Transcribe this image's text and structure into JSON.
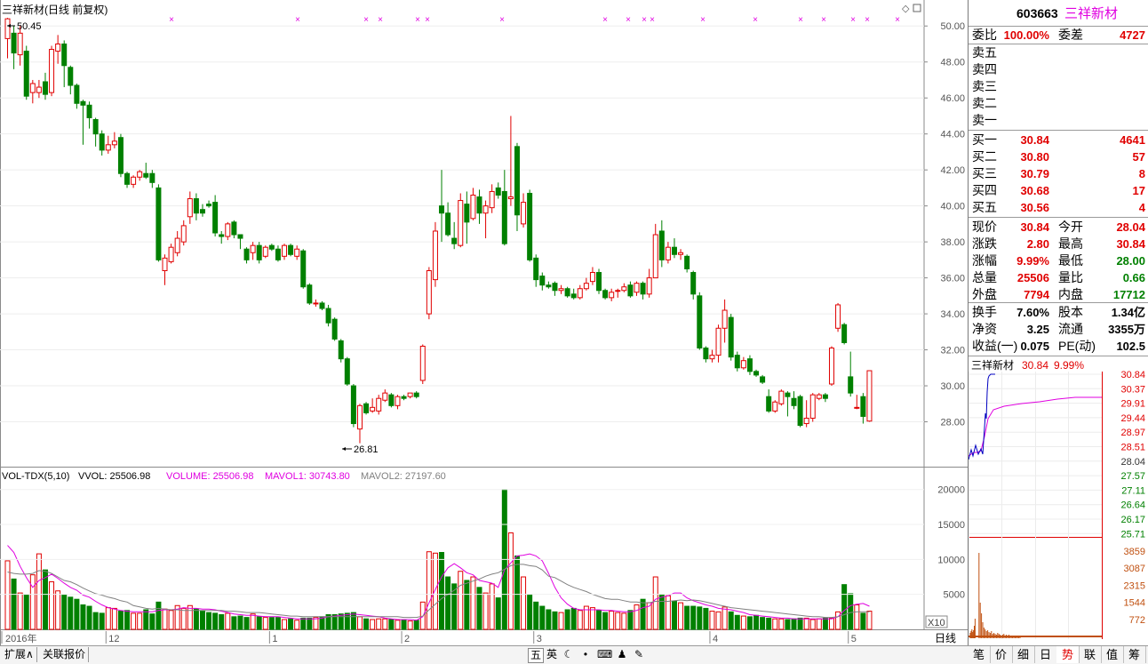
{
  "chart_title": "三祥新材(日线 前复权)",
  "high_marker": "50.45",
  "low_marker": "26.81",
  "price_axis": [
    "50.00",
    "48.00",
    "46.00",
    "44.00",
    "42.00",
    "40.00",
    "38.00",
    "36.00",
    "34.00",
    "32.00",
    "30.00",
    "28.00"
  ],
  "vol_indicator": {
    "name": "VOL-TDX(5,10)",
    "vvol": "VVOL: 25506.98",
    "volume": "VOLUME: 25506.98",
    "mavol1": "MAVOL1: 30743.80",
    "mavol2": "MAVOL2: 27197.60"
  },
  "vol_axis": [
    "20000",
    "15000",
    "10000",
    "5000"
  ],
  "vol_unit": "X10",
  "x_axis": [
    "2016年",
    "12",
    "1",
    "2",
    "3",
    "4",
    "5"
  ],
  "period_label": "日线",
  "bottom_tabs": [
    "扩展∧",
    "关联报价"
  ],
  "ime": {
    "label1": "五",
    "label2": "英"
  },
  "quote": {
    "code": "603663",
    "name": "三祥新材",
    "weibi_label": "委比",
    "weibi": "100.00%",
    "weicha_label": "委差",
    "weicha": "4727",
    "sell": [
      {
        "label": "卖五"
      },
      {
        "label": "卖四"
      },
      {
        "label": "卖三"
      },
      {
        "label": "卖二"
      },
      {
        "label": "卖一"
      }
    ],
    "buy": [
      {
        "label": "买一",
        "price": "30.84",
        "vol": "4641"
      },
      {
        "label": "买二",
        "price": "30.80",
        "vol": "57"
      },
      {
        "label": "买三",
        "price": "30.79",
        "vol": "8"
      },
      {
        "label": "买四",
        "price": "30.68",
        "vol": "17"
      },
      {
        "label": "买五",
        "price": "30.56",
        "vol": "4"
      }
    ],
    "stats": [
      {
        "l1": "现价",
        "v1": "30.84",
        "l2": "今开",
        "v2": "28.04",
        "c1": "red",
        "c2": "red"
      },
      {
        "l1": "涨跌",
        "v1": "2.80",
        "l2": "最高",
        "v2": "30.84",
        "c1": "red",
        "c2": "red"
      },
      {
        "l1": "涨幅",
        "v1": "9.99%",
        "l2": "最低",
        "v2": "28.00",
        "c1": "red",
        "c2": "green"
      },
      {
        "l1": "总量",
        "v1": "25506",
        "l2": "量比",
        "v2": "0.66",
        "c1": "red",
        "c2": "green"
      },
      {
        "l1": "外盘",
        "v1": "7794",
        "l2": "内盘",
        "v2": "17712",
        "c1": "red",
        "c2": "green"
      }
    ],
    "fin": [
      {
        "l1": "换手",
        "v1": "7.60%",
        "l2": "股本",
        "v2": "1.34亿"
      },
      {
        "l1": "净资",
        "v1": "3.25",
        "l2": "流通",
        "v2": "3355万"
      },
      {
        "l1": "收益(一)",
        "v1": "0.075",
        "l2": "PE(动)",
        "v2": "102.5"
      }
    ],
    "mini_title": "三祥新材",
    "mini_price": "30.84",
    "mini_pct": "9.99%",
    "mini_axis": [
      "30.84",
      "30.37",
      "29.91",
      "29.44",
      "28.97",
      "28.51",
      "28.04",
      "27.57",
      "27.11",
      "26.64",
      "26.17",
      "25.71"
    ],
    "mini_vol_axis": [
      "3859",
      "3087",
      "2315",
      "1544",
      "772"
    ],
    "side_tabs": [
      "笔",
      "价",
      "细",
      "日",
      "势",
      "联",
      "值",
      "筹"
    ]
  },
  "colors": {
    "up": "#e00000",
    "down": "#008000",
    "ma1": "#e000e0",
    "ma2": "#808080",
    "axis": "#e00000"
  },
  "chart_data": {
    "type": "candlestick",
    "title": "三祥新材(日线 前复权)",
    "ylim": [
      26.0,
      51.0
    ],
    "x_ticks": [
      "2016年",
      "12",
      "1",
      "2",
      "3",
      "4",
      "5"
    ],
    "candles": [
      [
        49.3,
        50.4,
        48.2,
        50.45
      ],
      [
        49.6,
        48.5,
        47.6,
        50.0
      ],
      [
        48.4,
        49.6,
        47.8,
        50.0
      ],
      [
        48.6,
        46.1,
        45.9,
        48.9
      ],
      [
        46.3,
        46.8,
        45.7,
        47.0
      ],
      [
        46.3,
        46.6,
        46.0,
        47.0
      ],
      [
        46.9,
        46.2,
        45.9,
        47.4
      ],
      [
        46.3,
        48.7,
        46.1,
        48.9
      ],
      [
        48.6,
        49.0,
        47.9,
        49.5
      ],
      [
        49.0,
        47.8,
        46.6,
        49.2
      ],
      [
        47.7,
        46.7,
        46.2,
        47.8
      ],
      [
        46.7,
        45.7,
        45.4,
        46.8
      ],
      [
        45.8,
        45.6,
        43.4,
        45.9
      ],
      [
        45.6,
        44.9,
        44.3,
        45.8
      ],
      [
        44.8,
        44.0,
        43.3,
        44.9
      ],
      [
        44.0,
        43.1,
        42.8,
        44.2
      ],
      [
        43.1,
        43.4,
        42.9,
        43.9
      ],
      [
        43.4,
        43.6,
        43.2,
        44.1
      ],
      [
        43.8,
        41.8,
        41.6,
        44.0
      ],
      [
        41.8,
        41.2,
        41.0,
        41.9
      ],
      [
        41.2,
        41.6,
        41.0,
        41.7
      ],
      [
        41.6,
        41.9,
        41.4,
        42.0
      ],
      [
        41.8,
        41.6,
        41.5,
        42.4
      ],
      [
        41.8,
        41.3,
        41.0,
        42.0
      ],
      [
        41.0,
        37.0,
        36.9,
        41.2
      ],
      [
        36.4,
        37.1,
        35.6,
        37.3
      ],
      [
        36.9,
        37.7,
        36.8,
        37.9
      ],
      [
        37.4,
        38.2,
        37.2,
        38.6
      ],
      [
        38.0,
        38.9,
        37.8,
        39.2
      ],
      [
        39.4,
        40.4,
        39.0,
        40.8
      ],
      [
        40.4,
        39.6,
        39.2,
        40.7
      ],
      [
        39.8,
        39.6,
        39.4,
        40.1
      ],
      [
        40.1,
        40.0,
        39.9,
        40.3
      ],
      [
        40.2,
        38.5,
        38.3,
        40.6
      ],
      [
        38.4,
        38.3,
        37.9,
        38.6
      ],
      [
        38.3,
        39.0,
        38.1,
        39.1
      ],
      [
        39.1,
        38.4,
        38.2,
        39.2
      ],
      [
        38.4,
        38.2,
        37.6,
        38.4
      ],
      [
        37.6,
        37.0,
        36.8,
        37.7
      ],
      [
        37.4,
        37.8,
        37.0,
        38.0
      ],
      [
        37.8,
        37.0,
        36.8,
        38.0
      ],
      [
        37.2,
        37.7,
        37.1,
        37.8
      ],
      [
        37.8,
        37.6,
        37.5,
        37.9
      ],
      [
        37.6,
        37.0,
        36.9,
        37.8
      ],
      [
        37.2,
        37.8,
        37.0,
        37.9
      ],
      [
        37.8,
        37.3,
        37.2,
        37.9
      ],
      [
        37.2,
        37.6,
        37.0,
        37.8
      ],
      [
        37.5,
        35.5,
        35.4,
        37.6
      ],
      [
        35.6,
        34.6,
        34.5,
        35.7
      ],
      [
        34.6,
        34.6,
        34.4,
        34.8
      ],
      [
        34.6,
        34.3,
        34.2,
        34.7
      ],
      [
        34.3,
        33.5,
        33.3,
        34.5
      ],
      [
        33.7,
        32.6,
        32.5,
        33.8
      ],
      [
        32.5,
        31.5,
        31.3,
        32.6
      ],
      [
        31.5,
        30.1,
        30.0,
        31.6
      ],
      [
        30.0,
        27.9,
        27.7,
        30.1
      ],
      [
        27.6,
        28.9,
        26.81,
        29.0
      ],
      [
        29.0,
        28.5,
        28.4,
        29.1
      ],
      [
        28.6,
        28.8,
        28.5,
        29.3
      ],
      [
        28.6,
        29.3,
        28.4,
        29.5
      ],
      [
        29.2,
        29.6,
        29.1,
        29.8
      ],
      [
        29.5,
        28.9,
        28.8,
        29.6
      ],
      [
        28.9,
        29.4,
        28.7,
        29.5
      ],
      [
        29.4,
        29.3,
        29.2,
        29.5
      ],
      [
        29.4,
        29.6,
        29.3,
        29.6
      ],
      [
        29.6,
        29.4,
        29.3,
        29.7
      ],
      [
        30.3,
        32.2,
        30.1,
        32.3
      ],
      [
        34.0,
        36.4,
        33.7,
        36.6
      ],
      [
        35.9,
        38.6,
        35.5,
        39.1
      ],
      [
        40.0,
        39.6,
        38.0,
        42.0
      ],
      [
        39.6,
        38.4,
        38.3,
        40.2
      ],
      [
        38.2,
        37.9,
        37.6,
        39.1
      ],
      [
        37.8,
        40.3,
        37.7,
        40.7
      ],
      [
        40.1,
        39.1,
        37.9,
        40.8
      ],
      [
        39.3,
        40.6,
        39.2,
        41.0
      ],
      [
        40.5,
        39.6,
        39.0,
        40.9
      ],
      [
        39.6,
        40.0,
        38.2,
        40.3
      ],
      [
        39.9,
        40.8,
        39.6,
        41.2
      ],
      [
        41.0,
        40.6,
        40.4,
        41.3
      ],
      [
        40.8,
        37.9,
        37.8,
        42.0
      ],
      [
        40.4,
        40.5,
        40.0,
        45.0
      ],
      [
        43.3,
        39.5,
        38.6,
        43.5
      ],
      [
        39.0,
        40.2,
        38.8,
        40.7
      ],
      [
        40.7,
        37.0,
        36.9,
        40.9
      ],
      [
        37.1,
        35.9,
        35.5,
        37.3
      ],
      [
        36.1,
        35.6,
        35.3,
        36.3
      ],
      [
        35.6,
        35.5,
        35.4,
        35.8
      ],
      [
        35.7,
        35.3,
        35.0,
        35.8
      ],
      [
        35.3,
        35.4,
        35.1,
        35.6
      ],
      [
        35.4,
        35.0,
        34.9,
        35.5
      ],
      [
        35.1,
        34.9,
        34.8,
        35.4
      ],
      [
        34.9,
        35.4,
        34.8,
        35.6
      ],
      [
        35.4,
        35.7,
        35.3,
        36.0
      ],
      [
        35.8,
        36.3,
        35.6,
        36.6
      ],
      [
        36.3,
        35.3,
        35.1,
        36.5
      ],
      [
        35.3,
        34.9,
        34.8,
        35.4
      ],
      [
        34.9,
        35.2,
        34.7,
        35.4
      ],
      [
        35.3,
        35.3,
        34.9,
        35.4
      ],
      [
        35.3,
        35.5,
        35.2,
        35.7
      ],
      [
        35.6,
        35.0,
        34.9,
        35.8
      ],
      [
        35.2,
        35.7,
        35.0,
        35.8
      ],
      [
        35.7,
        35.1,
        34.8,
        35.8
      ],
      [
        35.1,
        36.0,
        34.9,
        36.5
      ],
      [
        36.0,
        38.4,
        36.0,
        39.0
      ],
      [
        38.6,
        37.0,
        36.6,
        39.2
      ],
      [
        37.0,
        37.7,
        36.8,
        38.0
      ],
      [
        37.7,
        37.3,
        37.1,
        38.2
      ],
      [
        37.3,
        37.4,
        37.0,
        37.6
      ],
      [
        37.2,
        36.5,
        36.3,
        37.3
      ],
      [
        36.3,
        35.1,
        34.8,
        36.4
      ],
      [
        35.0,
        32.1,
        32.0,
        35.2
      ],
      [
        32.1,
        31.5,
        31.3,
        32.2
      ],
      [
        31.5,
        31.7,
        31.3,
        32.0
      ],
      [
        31.7,
        33.2,
        31.3,
        33.4
      ],
      [
        33.2,
        34.2,
        32.4,
        34.8
      ],
      [
        33.8,
        31.6,
        31.4,
        34.0
      ],
      [
        31.7,
        31.0,
        30.8,
        31.9
      ],
      [
        31.0,
        31.4,
        30.9,
        31.6
      ],
      [
        31.5,
        30.8,
        30.6,
        31.7
      ],
      [
        30.8,
        30.6,
        30.5,
        30.9
      ],
      [
        30.5,
        30.2,
        30.1,
        30.6
      ],
      [
        29.4,
        28.6,
        28.5,
        29.8
      ],
      [
        28.6,
        29.1,
        28.5,
        29.2
      ],
      [
        29.0,
        29.7,
        28.9,
        29.8
      ],
      [
        29.6,
        29.4,
        28.3,
        29.7
      ],
      [
        29.3,
        28.9,
        28.7,
        29.7
      ],
      [
        29.4,
        27.8,
        27.7,
        29.5
      ],
      [
        27.9,
        28.2,
        27.7,
        29.2
      ],
      [
        28.2,
        29.5,
        28.0,
        29.6
      ],
      [
        29.3,
        29.5,
        29.2,
        29.6
      ],
      [
        29.5,
        29.3,
        29.1,
        29.6
      ],
      [
        30.1,
        32.1,
        30.0,
        32.2
      ],
      [
        33.2,
        34.5,
        33.0,
        34.6
      ],
      [
        33.4,
        32.4,
        32.3,
        33.5
      ],
      [
        30.5,
        29.6,
        29.4,
        31.9
      ],
      [
        28.8,
        28.8,
        28.7,
        29.5
      ],
      [
        29.4,
        28.3,
        27.9,
        29.6
      ],
      [
        28.04,
        30.84,
        28.0,
        30.84
      ]
    ],
    "volume": [
      9800,
      7200,
      5200,
      4900,
      7800,
      10800,
      8500,
      6800,
      5500,
      4900,
      4600,
      4300,
      3500,
      3300,
      2400,
      2300,
      3100,
      3000,
      2600,
      2700,
      2300,
      2300,
      2800,
      2200,
      3900,
      2900,
      2700,
      3400,
      3000,
      3400,
      2900,
      2600,
      2400,
      2300,
      2100,
      2300,
      1800,
      1900,
      1700,
      2200,
      1800,
      1700,
      1700,
      1700,
      1400,
      1500,
      1300,
      1600,
      1600,
      1700,
      1800,
      2100,
      2100,
      2200,
      2300,
      2400,
      1800,
      1500,
      1400,
      1500,
      1500,
      1400,
      1300,
      1300,
      1200,
      1300,
      3900,
      11100,
      10900,
      11000,
      7500,
      6500,
      8300,
      7000,
      7500,
      6000,
      5200,
      6500,
      4500,
      20000,
      13800,
      10500,
      7500,
      5000,
      3900,
      3300,
      2800,
      2500,
      2400,
      2800,
      3000,
      2700,
      3300,
      3100,
      2700,
      2400,
      2600,
      2400,
      2300,
      2700,
      3500,
      4300,
      3800,
      7500,
      5000,
      4800,
      4000,
      3800,
      3300,
      3300,
      3200,
      3000,
      2600,
      2500,
      3200,
      2500,
      2000,
      1900,
      1800,
      2000,
      1700,
      1600,
      1500,
      1500,
      1400,
      1500,
      1600,
      1600,
      1400,
      1500,
      1600,
      1600,
      2500,
      6400,
      5100,
      3500,
      2300,
      2600
    ],
    "mavol1": [
      12000,
      11000,
      9000,
      7400,
      6000,
      7000,
      7400,
      7900,
      7300,
      6600,
      6000,
      5600,
      4900,
      4600,
      4000,
      3500,
      3100,
      2900,
      2700,
      2600,
      2500,
      2500,
      2500,
      2500,
      2700,
      2800,
      2800,
      2900,
      3100,
      3000,
      3000,
      2900,
      2900,
      2800,
      2600,
      2400,
      2200,
      2100,
      2000,
      2000,
      1900,
      1800,
      1800,
      1800,
      1700,
      1600,
      1500,
      1500,
      1500,
      1500,
      1600,
      1800,
      1900,
      2000,
      2100,
      2200,
      2100,
      2000,
      1900,
      1800,
      1600,
      1500,
      1400,
      1400,
      1400,
      1300,
      1800,
      3800,
      5700,
      7500,
      8800,
      9400,
      8800,
      8100,
      7800,
      7000,
      6800,
      6600,
      6000,
      8500,
      9500,
      10500,
      10600,
      10800,
      10500,
      9800,
      8000,
      6000,
      4500,
      3600,
      3000,
      2800,
      2800,
      2800,
      2800,
      2700,
      2700,
      2600,
      2500,
      2500,
      2700,
      3100,
      3300,
      4300,
      4600,
      4800,
      5200,
      5200,
      4500,
      4100,
      3800,
      3500,
      3300,
      3000,
      2900,
      2800,
      2600,
      2400,
      2100,
      2000,
      1900,
      1800,
      1700,
      1600,
      1600,
      1500,
      1500,
      1500,
      1500,
      1500,
      1500,
      1500,
      1800,
      2700,
      3400,
      3600,
      3700,
      3300
    ],
    "mavol2": [
      8200,
      8000,
      7900,
      7900,
      8000,
      8400,
      8300,
      8000,
      7500,
      7000,
      6800,
      6400,
      5900,
      5500,
      5100,
      4900,
      4600,
      4400,
      4100,
      3900,
      3400,
      3200,
      3000,
      2900,
      3000,
      2900,
      2800,
      2800,
      2700,
      2700,
      2700,
      2700,
      2700,
      2700,
      2700,
      2600,
      2600,
      2500,
      2400,
      2400,
      2400,
      2300,
      2200,
      2100,
      2000,
      1900,
      1900,
      1800,
      1800,
      1800,
      1800,
      1800,
      1800,
      1800,
      1800,
      1800,
      1800,
      1800,
      1800,
      1800,
      1800,
      1800,
      1800,
      1700,
      1700,
      1700,
      1900,
      2800,
      3600,
      4400,
      5000,
      5600,
      6300,
      6600,
      6900,
      7200,
      7600,
      7900,
      8100,
      8600,
      9100,
      9300,
      9300,
      9100,
      9000,
      8500,
      7600,
      7400,
      6900,
      6400,
      6000,
      5700,
      5400,
      5000,
      4700,
      4400,
      4300,
      4300,
      4100,
      3900,
      3900,
      3800,
      3800,
      4000,
      4000,
      4000,
      4100,
      4200,
      4100,
      4200,
      4100,
      3900,
      3700,
      3500,
      3300,
      3100,
      3000,
      2900,
      2800,
      2700,
      2600,
      2500,
      2400,
      2300,
      2200,
      2100,
      2000,
      1900,
      1800,
      1800,
      1700,
      1700,
      1800,
      2100,
      2400,
      2500,
      2500,
      2500
    ],
    "vol_ylim": [
      0,
      22000
    ],
    "markers": [
      193,
      335,
      412,
      428,
      470,
      481,
      565,
      681,
      707,
      725,
      734,
      791,
      850,
      901,
      927,
      960,
      976,
      1010
    ]
  }
}
